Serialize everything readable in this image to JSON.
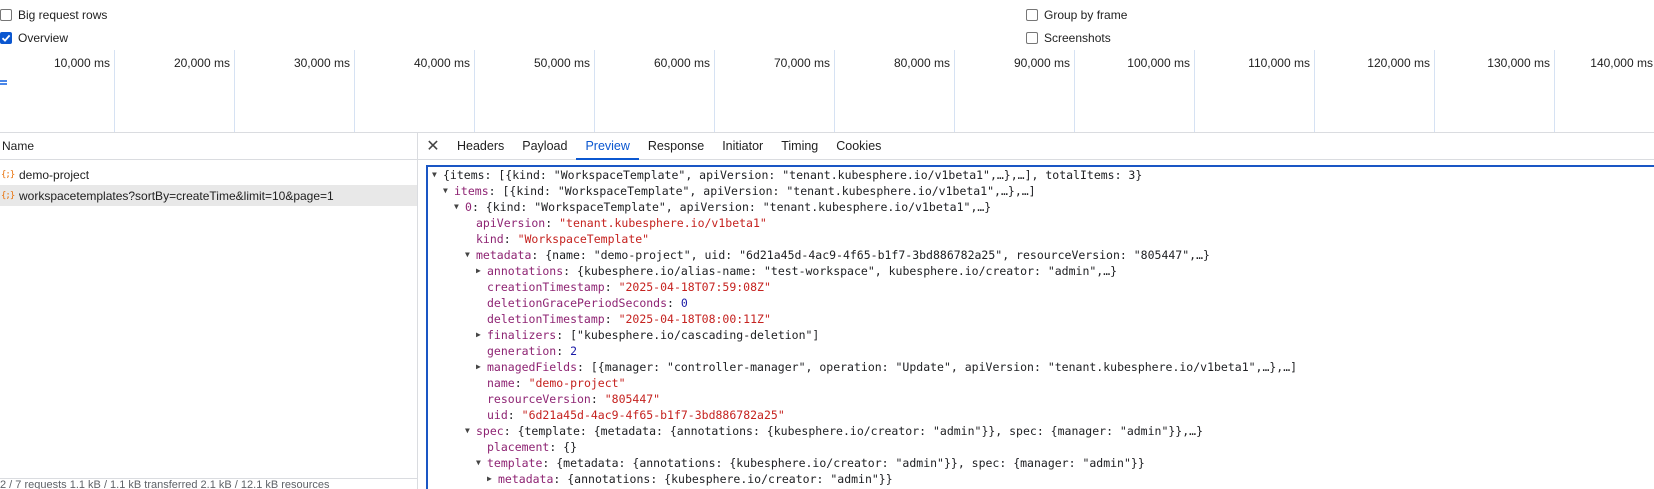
{
  "options": {
    "big_request_rows": "Big request rows",
    "overview": "Overview",
    "group_by_frame": "Group by frame",
    "screenshots": "Screenshots"
  },
  "timeline": {
    "ticks": [
      "10,000 ms",
      "20,000 ms",
      "30,000 ms",
      "40,000 ms",
      "50,000 ms",
      "60,000 ms",
      "70,000 ms",
      "80,000 ms",
      "90,000 ms",
      "100,000 ms",
      "110,000 ms",
      "120,000 ms",
      "130,000 ms",
      "140,000 ms"
    ]
  },
  "requests": {
    "header": "Name",
    "rows": [
      {
        "icon": "{;}",
        "name": "demo-project"
      },
      {
        "icon": "{;}",
        "name": "workspacetemplates?sortBy=createTime&limit=10&page=1"
      }
    ],
    "footer": "2 / 7 requests   1.1 kB / 1.1 kB transferred   2.1 kB / 12.1 kB resources"
  },
  "tabs": {
    "close": "✕",
    "items": [
      "Headers",
      "Payload",
      "Preview",
      "Response",
      "Initiator",
      "Timing",
      "Cookies"
    ],
    "active": "Preview"
  },
  "preview": {
    "l1": "{items: [{kind: \"WorkspaceTemplate\", apiVersion: \"tenant.kubesphere.io/v1beta1\",…},…], totalItems: 3}",
    "l2_key": "items",
    "l2_val": "[{kind: \"WorkspaceTemplate\", apiVersion: \"tenant.kubesphere.io/v1beta1\",…},…]",
    "l3_key": "0",
    "l3_val": "{kind: \"WorkspaceTemplate\", apiVersion: \"tenant.kubesphere.io/v1beta1\",…}",
    "l4_key": "apiVersion",
    "l4_val": "\"tenant.kubesphere.io/v1beta1\"",
    "l5_key": "kind",
    "l5_val": "\"WorkspaceTemplate\"",
    "l6_key": "metadata",
    "l6_val": "{name: \"demo-project\", uid: \"6d21a45d-4ac9-4f65-b1f7-3bd886782a25\", resourceVersion: \"805447\",…}",
    "l7_key": "annotations",
    "l7_val": "{kubesphere.io/alias-name: \"test-workspace\", kubesphere.io/creator: \"admin\",…}",
    "l8_key": "creationTimestamp",
    "l8_val": "\"2025-04-18T07:59:08Z\"",
    "l9_key": "deletionGracePeriodSeconds",
    "l9_val": "0",
    "l10_key": "deletionTimestamp",
    "l10_val": "\"2025-04-18T08:00:11Z\"",
    "l11_key": "finalizers",
    "l11_val": "[\"kubesphere.io/cascading-deletion\"]",
    "l12_key": "generation",
    "l12_val": "2",
    "l13_key": "managedFields",
    "l13_val": "[{manager: \"controller-manager\", operation: \"Update\", apiVersion: \"tenant.kubesphere.io/v1beta1\",…},…]",
    "l14_key": "name",
    "l14_val": "\"demo-project\"",
    "l15_key": "resourceVersion",
    "l15_val": "\"805447\"",
    "l16_key": "uid",
    "l16_val": "\"6d21a45d-4ac9-4f65-b1f7-3bd886782a25\"",
    "l17_key": "spec",
    "l17_val": "{template: {metadata: {annotations: {kubesphere.io/creator: \"admin\"}}, spec: {manager: \"admin\"}},…}",
    "l18_key": "placement",
    "l18_val": "{}",
    "l19_key": "template",
    "l19_val": "{metadata: {annotations: {kubesphere.io/creator: \"admin\"}}, spec: {manager: \"admin\"}}",
    "l20_key": "metadata",
    "l20_val": "{annotations: {kubesphere.io/creator: \"admin\"}}"
  }
}
